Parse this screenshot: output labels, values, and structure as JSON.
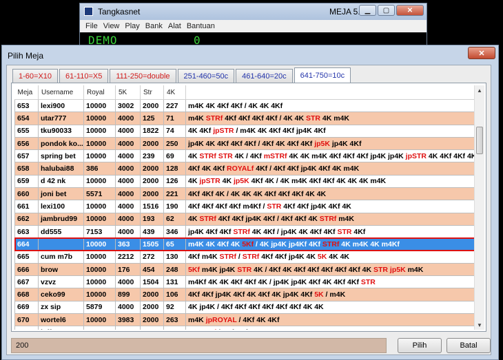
{
  "bg_window": {
    "title": "Tangkasnet",
    "meja": "MEJA 5...",
    "menu": [
      "File",
      "View",
      "Play",
      "Bank",
      "Alat",
      "Bantuan"
    ],
    "demo": "DEMO",
    "counter": "0"
  },
  "dialog": {
    "title": "Pilih Meja",
    "tabs": [
      {
        "label": "1-60=X10",
        "color": "#d11a1a"
      },
      {
        "label": "61-110=X5",
        "color": "#d11a1a"
      },
      {
        "label": "111-250=double",
        "color": "#d11a1a"
      },
      {
        "label": "251-460=50c",
        "color": "#2233aa"
      },
      {
        "label": "461-640=20c",
        "color": "#2233aa"
      },
      {
        "label": "641-750=10c",
        "color": "#2233aa"
      }
    ],
    "active_tab": 5,
    "columns": [
      "Meja",
      "Username",
      "Royal",
      "5K",
      "Str",
      "4K",
      ""
    ],
    "rows": [
      {
        "meja": "653",
        "user": "lexi900",
        "royal": "10000",
        "k5": "3002",
        "str": "2000",
        "k4": "227",
        "cards": [
          [
            "m4K 4K 4Kf 4Kf / 4K 4K 4Kf",
            0
          ]
        ]
      },
      {
        "meja": "654",
        "user": "utar777",
        "royal": "10000",
        "k5": "4000",
        "str": "125",
        "k4": "71",
        "cards": [
          [
            "m4K ",
            0
          ],
          [
            "STRf",
            1
          ],
          [
            " 4Kf 4Kf 4Kf 4Kf / 4K 4K ",
            0
          ],
          [
            "STR",
            1
          ],
          [
            " 4K m4K",
            0
          ]
        ]
      },
      {
        "meja": "655",
        "user": "tku90033",
        "royal": "10000",
        "k5": "4000",
        "str": "1822",
        "k4": "74",
        "cards": [
          [
            "4K 4Kf ",
            0
          ],
          [
            "jpSTR",
            1
          ],
          [
            " / m4K 4K 4Kf 4Kf jp4K 4Kf",
            0
          ]
        ]
      },
      {
        "meja": "656",
        "user": "pondok ko...",
        "royal": "10000",
        "k5": "4000",
        "str": "2000",
        "k4": "250",
        "cards": [
          [
            "jp4K 4K 4Kf 4Kf 4Kf / 4Kf 4K 4Kf 4Kf ",
            0
          ],
          [
            "jp5K",
            1
          ],
          [
            " jp4K 4Kf",
            0
          ]
        ]
      },
      {
        "meja": "657",
        "user": "spring bet",
        "royal": "10000",
        "k5": "4000",
        "str": "239",
        "k4": "69",
        "cards": [
          [
            "4K ",
            0
          ],
          [
            "STRf STR",
            1
          ],
          [
            " 4K / 4Kf ",
            0
          ],
          [
            "mSTRf",
            1
          ],
          [
            " 4K 4K m4K 4Kf 4Kf 4Kf jp4K jp4K ",
            0
          ],
          [
            "jpSTR",
            1
          ],
          [
            " 4K 4Kf 4Kf 4K",
            0
          ]
        ]
      },
      {
        "meja": "658",
        "user": "halubai88",
        "royal": "386",
        "k5": "4000",
        "str": "2000",
        "k4": "128",
        "cards": [
          [
            "4Kf 4K 4Kf ",
            0
          ],
          [
            "ROYALf",
            1
          ],
          [
            " 4Kf / 4Kf 4Kf jp4K 4Kf 4K m4K",
            0
          ]
        ]
      },
      {
        "meja": "659",
        "user": "d 42 nk",
        "royal": "10000",
        "k5": "4000",
        "str": "2000",
        "k4": "126",
        "cards": [
          [
            "4K ",
            0
          ],
          [
            "jpSTR",
            1
          ],
          [
            " 4K ",
            0
          ],
          [
            "jp5K",
            1
          ],
          [
            " 4Kf 4K / 4K m4K 4Kf 4Kf 4K 4K 4K m4K",
            0
          ]
        ]
      },
      {
        "meja": "660",
        "user": "joni bet",
        "royal": "5571",
        "k5": "4000",
        "str": "2000",
        "k4": "221",
        "cards": [
          [
            "4Kf 4Kf 4K / 4K 4K 4K 4Kf 4Kf 4Kf 4K 4K",
            0
          ]
        ]
      },
      {
        "meja": "661",
        "user": "lexi100",
        "royal": "10000",
        "k5": "4000",
        "str": "1516",
        "k4": "190",
        "cards": [
          [
            "4Kf 4Kf 4Kf 4Kf m4Kf / ",
            0
          ],
          [
            "STR",
            1
          ],
          [
            " 4Kf 4Kf jp4K 4Kf 4K",
            0
          ]
        ]
      },
      {
        "meja": "662",
        "user": "jambrud99",
        "royal": "10000",
        "k5": "4000",
        "str": "193",
        "k4": "62",
        "cards": [
          [
            "4K ",
            0
          ],
          [
            "STRf",
            1
          ],
          [
            " 4Kf 4Kf jp4K 4Kf / 4Kf 4Kf 4K ",
            0
          ],
          [
            "STRf",
            1
          ],
          [
            " m4K",
            0
          ]
        ]
      },
      {
        "meja": "663",
        "user": "dd555",
        "royal": "7153",
        "k5": "4000",
        "str": "439",
        "k4": "346",
        "cards": [
          [
            "jp4K 4Kf 4Kf ",
            0
          ],
          [
            "STRf",
            1
          ],
          [
            " 4K 4Kf / jp4K 4K 4Kf 4Kf ",
            0
          ],
          [
            "STR",
            1
          ],
          [
            " 4Kf",
            0
          ]
        ]
      },
      {
        "meja": "664",
        "user": "",
        "royal": "10000",
        "k5": "363",
        "str": "1505",
        "k4": "65",
        "selected": true,
        "cards": [
          [
            "m4K 4K 4Kf 4K ",
            0
          ],
          [
            "5Kf",
            1
          ],
          [
            " / 4K jp4K jp4Kf 4Kf ",
            0
          ],
          [
            "STRf",
            1
          ],
          [
            " 4K m4K 4K m4Kf",
            0
          ]
        ]
      },
      {
        "meja": "665",
        "user": "cum m7b",
        "royal": "10000",
        "k5": "2212",
        "str": "272",
        "k4": "130",
        "cards": [
          [
            "4Kf m4K ",
            0
          ],
          [
            "STRf",
            1
          ],
          [
            " / ",
            0
          ],
          [
            "STRf",
            1
          ],
          [
            " 4Kf 4Kf jp4K 4K ",
            0
          ],
          [
            "5K",
            1
          ],
          [
            " 4K 4K",
            0
          ]
        ]
      },
      {
        "meja": "666",
        "user": "brow",
        "royal": "10000",
        "k5": "176",
        "str": "454",
        "k4": "248",
        "cards": [
          [
            "5Kf",
            1
          ],
          [
            " m4K jp4K ",
            0
          ],
          [
            "STR",
            1
          ],
          [
            " 4K / 4Kf 4K 4Kf 4Kf 4Kf 4Kf 4Kf 4K ",
            0
          ],
          [
            "STR jp5K",
            1
          ],
          [
            " m4K",
            0
          ]
        ]
      },
      {
        "meja": "667",
        "user": "vzvz",
        "royal": "10000",
        "k5": "4000",
        "str": "1504",
        "k4": "131",
        "cards": [
          [
            "m4Kf 4K 4K 4Kf 4Kf 4K / jp4K jp4K 4Kf 4K 4Kf 4Kf ",
            0
          ],
          [
            "STR",
            1
          ]
        ]
      },
      {
        "meja": "668",
        "user": "ceko99",
        "royal": "10000",
        "k5": "899",
        "str": "2000",
        "k4": "106",
        "cards": [
          [
            "4Kf 4Kf jp4K 4Kf 4K 4Kf 4K jp4K 4Kf ",
            0
          ],
          [
            "5K",
            1
          ],
          [
            " / m4K",
            0
          ]
        ]
      },
      {
        "meja": "669",
        "user": "zx sip",
        "royal": "5879",
        "k5": "4000",
        "str": "2000",
        "k4": "92",
        "cards": [
          [
            "4K jp4K / 4Kf 4Kf 4Kf 4Kf 4Kf 4Kf 4K 4K",
            0
          ]
        ]
      },
      {
        "meja": "670",
        "user": "wortel6",
        "royal": "10000",
        "k5": "3983",
        "str": "2000",
        "k4": "263",
        "cards": [
          [
            "m4K ",
            0
          ],
          [
            "jpROYAL",
            1
          ],
          [
            " / 4Kf 4K 4Kf",
            0
          ]
        ]
      },
      {
        "meja": "671",
        "user": "jeff1",
        "royal": "10000",
        "k5": "4000",
        "str": "428",
        "k4": "288",
        "cards": [
          [
            "4K ",
            0
          ],
          [
            "STRf",
            1
          ],
          [
            " / 4Kf 4Kf m4K 4K",
            0
          ]
        ]
      },
      {
        "meja": "672",
        "user": "168 bet",
        "royal": "10000",
        "k5": "3569",
        "str": "1081",
        "k4": "254",
        "cards": [
          [
            "/ 4K 4K 4Kf 4Kf 4K ",
            0
          ],
          [
            "STR",
            1
          ],
          [
            " 4Kf jp4K 4Kf",
            0
          ]
        ]
      }
    ],
    "bet_value": "200",
    "pilih_label": "Pilih",
    "batal_label": "Batal"
  }
}
